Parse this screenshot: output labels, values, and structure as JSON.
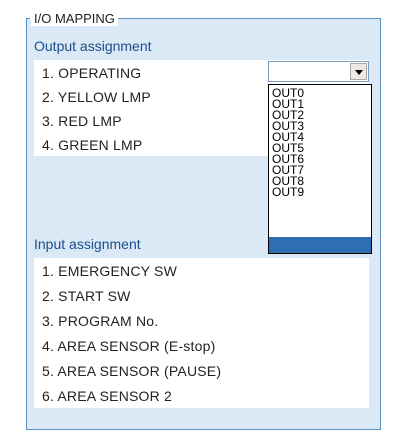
{
  "panel_title": "I/O MAPPING",
  "output": {
    "title": "Output assignment",
    "rows": [
      "1. OPERATING",
      "2. YELLOW LMP",
      "3. RED LMP",
      "4. GREEN LMP"
    ]
  },
  "dropdown": {
    "selected": "",
    "icon": "chevron-down-icon",
    "options": [
      "OUT0",
      "OUT1",
      "OUT2",
      "OUT3",
      "OUT4",
      "OUT5",
      "OUT6",
      "OUT7",
      "OUT8",
      "OUT9",
      ""
    ],
    "highlight_color": "#2d6fb1"
  },
  "input": {
    "title": "Input assignment",
    "rows": [
      "1. EMERGENCY SW",
      "2. START SW",
      "3. PROGRAM No.",
      "4. AREA SENSOR (E-stop)",
      "5. AREA SENSOR (PAUSE)",
      "6. AREA SENSOR 2"
    ]
  },
  "colors": {
    "panel_bg": "#dbe9f6",
    "panel_border": "#5b8fc4",
    "section_title": "#1b4f8a"
  }
}
